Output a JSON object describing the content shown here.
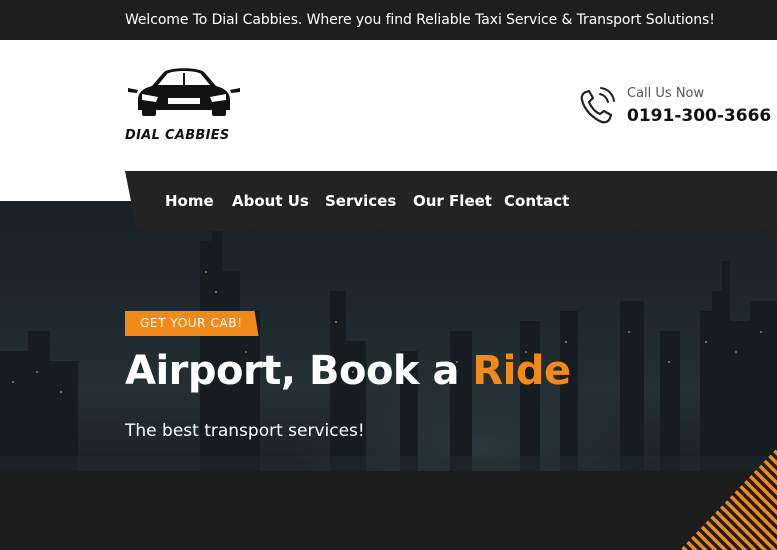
{
  "topbar": {
    "welcome_text": "Welcome To Dial Cabbies. Where you find Reliable Taxi Service & Transport Solutions!"
  },
  "brand": {
    "logo_text": "DIAL CABBIES"
  },
  "contact": {
    "label": "Call Us Now",
    "phone": "0191-300-3666"
  },
  "nav": {
    "items": [
      {
        "label": "Home"
      },
      {
        "label": "About Us"
      },
      {
        "label": "Services"
      },
      {
        "label": "Our Fleet"
      },
      {
        "label": "Contact"
      }
    ]
  },
  "hero": {
    "tag": "GET YOUR CAB!",
    "headline_main": "Airport, Book a ",
    "headline_accent": "Ride",
    "subline": "The best transport services!"
  },
  "colors": {
    "accent": "#f28a1a",
    "dark": "#232323",
    "topbar": "#1e1e1e"
  }
}
